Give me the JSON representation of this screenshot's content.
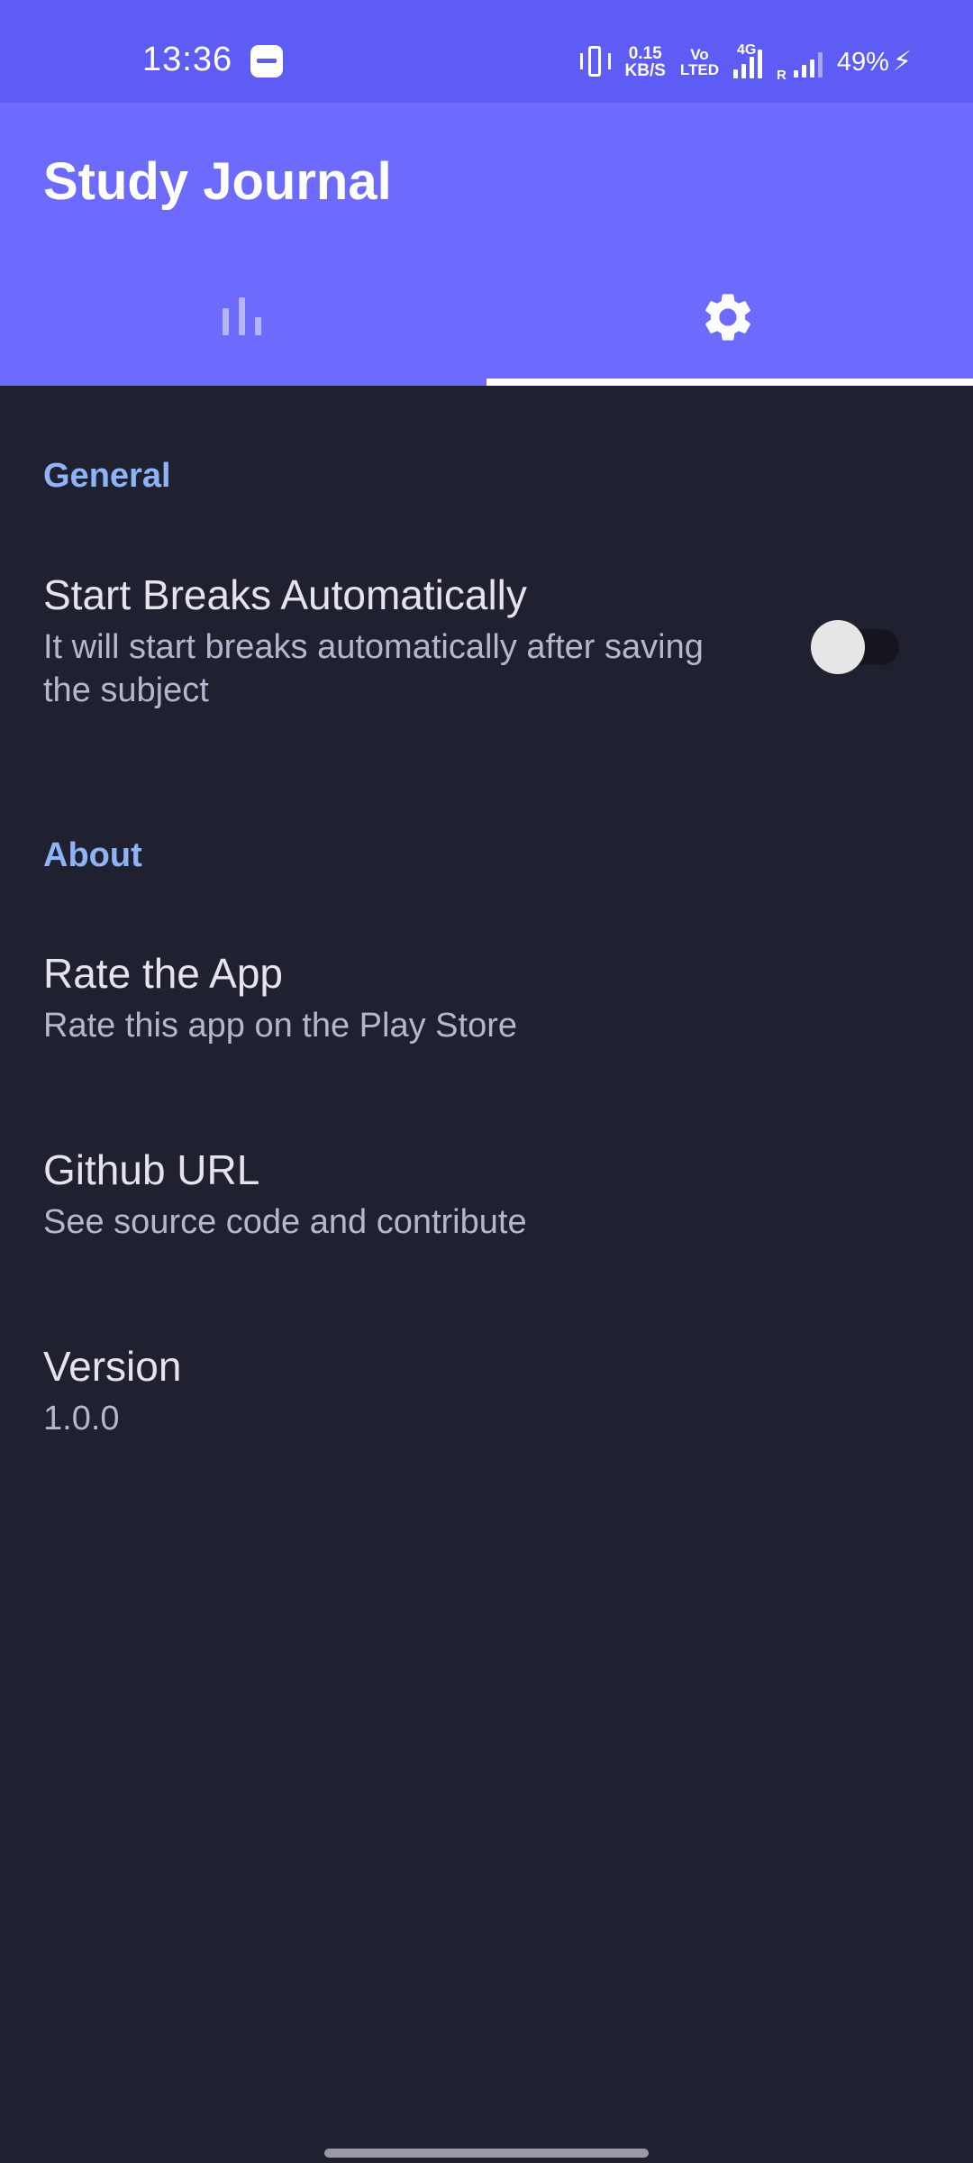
{
  "status_bar": {
    "time": "13:36",
    "net_speed_value": "0.15",
    "net_speed_unit": "KB/S",
    "volte_top": "Vo",
    "volte_bottom": "LTED",
    "network_type": "4G",
    "roaming_label": "R",
    "battery": "49%"
  },
  "app_bar": {
    "title": "Study Journal",
    "colors": {
      "status_bar": "#5d5cf5",
      "app_bar": "#6c6bfe",
      "background": "#1f2030",
      "section_header": "#8fb3f7"
    }
  },
  "tabs": [
    {
      "icon": "bar-chart-icon",
      "selected": false
    },
    {
      "icon": "gear-icon",
      "selected": true
    }
  ],
  "settings": {
    "general_header": "General",
    "start_breaks": {
      "title": "Start Breaks Automatically",
      "summary": "It will start breaks automatically after saving the subject",
      "enabled": false
    },
    "about_header": "About",
    "rate_app": {
      "title": "Rate the App",
      "summary": "Rate this app on the Play Store"
    },
    "github": {
      "title": "Github URL",
      "summary": "See source code and contribute"
    },
    "version": {
      "title": "Version",
      "summary": "1.0.0"
    }
  }
}
